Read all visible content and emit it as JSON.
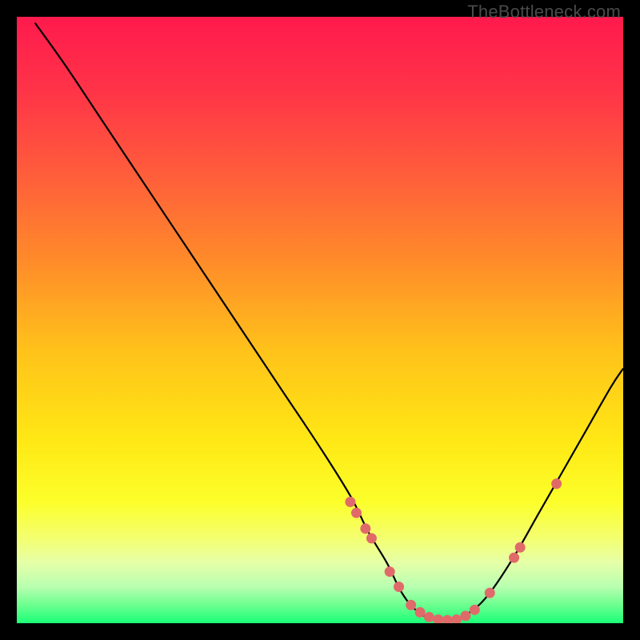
{
  "watermark": "TheBottleneck.com",
  "chart_data": {
    "type": "line",
    "title": "",
    "xlabel": "",
    "ylabel": "",
    "xlim": [
      0,
      100
    ],
    "ylim": [
      0,
      100
    ],
    "background_gradient": {
      "stops": [
        {
          "pos": 0.0,
          "color": "#ff1a4d"
        },
        {
          "pos": 0.12,
          "color": "#ff3348"
        },
        {
          "pos": 0.25,
          "color": "#ff5a3c"
        },
        {
          "pos": 0.4,
          "color": "#ff8a2a"
        },
        {
          "pos": 0.55,
          "color": "#ffc21a"
        },
        {
          "pos": 0.7,
          "color": "#ffe815"
        },
        {
          "pos": 0.8,
          "color": "#fcff2a"
        },
        {
          "pos": 0.86,
          "color": "#f4ff70"
        },
        {
          "pos": 0.9,
          "color": "#e6ffa8"
        },
        {
          "pos": 0.94,
          "color": "#b8ffb0"
        },
        {
          "pos": 0.97,
          "color": "#6cff90"
        },
        {
          "pos": 1.0,
          "color": "#1aff77"
        }
      ]
    },
    "series": [
      {
        "name": "curve",
        "type": "line",
        "color": "#000000",
        "x": [
          3,
          8,
          14,
          20,
          26,
          32,
          38,
          44,
          50,
          55,
          58,
          61,
          63.5,
          66,
          69,
          72,
          75,
          78,
          82,
          86,
          90,
          94,
          98,
          100
        ],
        "y": [
          99,
          92,
          83,
          74,
          65,
          56,
          47,
          38,
          29,
          21,
          15,
          10,
          5,
          2,
          0.5,
          0.5,
          2,
          5,
          11,
          18,
          25,
          32,
          39,
          42
        ]
      },
      {
        "name": "dots",
        "type": "scatter",
        "color": "#e06a6a",
        "x": [
          55.0,
          56.0,
          57.5,
          58.5,
          61.5,
          63.0,
          65.0,
          66.5,
          68.0,
          69.5,
          71.0,
          72.5,
          74.0,
          75.5,
          78.0,
          82.0,
          83.0,
          89.0
        ],
        "y": [
          20.0,
          18.2,
          15.6,
          14.0,
          8.5,
          6.0,
          3.0,
          1.8,
          1.0,
          0.6,
          0.5,
          0.6,
          1.2,
          2.2,
          5.0,
          10.8,
          12.5,
          23.0
        ]
      }
    ]
  }
}
